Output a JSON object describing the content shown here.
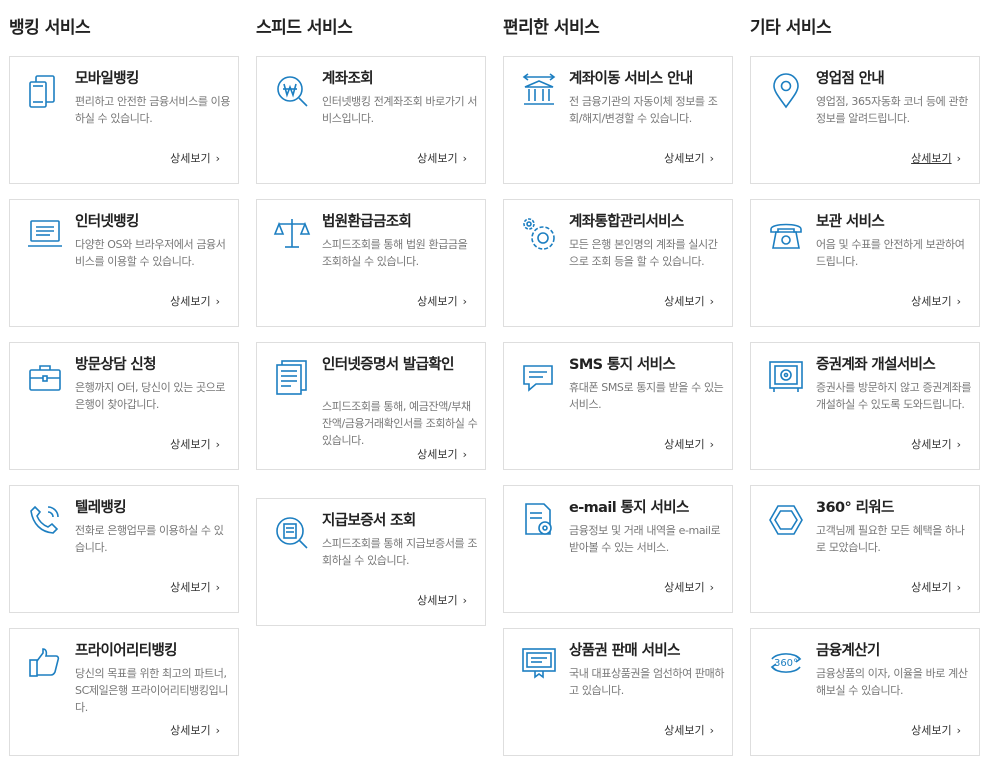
{
  "more_label": "상세보기",
  "chevron": "›",
  "accent": "#1d7fc1",
  "columns": [
    {
      "title": "뱅킹 서비스",
      "cards": [
        {
          "title": "모바일뱅킹",
          "desc": "편리하고 안전한 금융서비스를 이용하실 수 있습니다.",
          "icon": "mobile-icon"
        },
        {
          "title": "인터넷뱅킹",
          "desc": "다양한 OS와 브라우저에서 금융서비스를 이용할 수 있습니다.",
          "icon": "laptop-icon"
        },
        {
          "title": "방문상담 신청",
          "desc": "은행까지 O터, 당신이 있는 곳으로 은행이 찾아갑니다.",
          "icon": "briefcase-icon"
        },
        {
          "title": "텔레뱅킹",
          "desc": "전화로 은행업무를 이용하실 수 있습니다.",
          "icon": "phone-icon"
        },
        {
          "title": "프라이어리티뱅킹",
          "desc": "당신의 목표를 위한 최고의 파트너, SC제일은행 프라이어리티뱅킹입니다.",
          "icon": "thumbs-up-icon"
        }
      ]
    },
    {
      "title": "스피드 서비스",
      "cards": [
        {
          "title": "계좌조회",
          "desc": "인터넷뱅킹 전계좌조회 바로가기 서비스입니다.",
          "icon": "won-search-icon"
        },
        {
          "title": "법원환급금조회",
          "desc": "스피드조회를 통해 법원 환급금을 조회하실 수 있습니다.",
          "icon": "scale-icon"
        },
        {
          "title": "인터넷증명서 발급확인",
          "desc": "스피드조회를 통해, 예금잔액/부채잔액/금융거래확인서를 조회하실 수 있습니다.",
          "icon": "document-icon"
        },
        {
          "title": "지급보증서 조회",
          "desc": "스피드조회를 통해 지급보증서를 조회하실 수 있습니다.",
          "icon": "doc-search-icon"
        }
      ]
    },
    {
      "title": "편리한 서비스",
      "cards": [
        {
          "title": "계좌이동 서비스 안내",
          "desc": "전 금융기관의 자동이체 정보를 조회/해지/변경할 수 있습니다.",
          "icon": "bank-transfer-icon"
        },
        {
          "title": "계좌통합관리서비스",
          "desc": "모든 은행 본인명의 계좌를 실시간으로 조회 등을 할 수 있습니다.",
          "icon": "gears-icon"
        },
        {
          "title": "SMS 통지 서비스",
          "desc": "휴대폰 SMS로 통지를 받을 수 있는 서비스.",
          "icon": "chat-icon"
        },
        {
          "title": "e-mail 통지 서비스",
          "desc": "금융정보 및 거래 내역을 e-mail로 받아볼 수 있는 서비스.",
          "icon": "email-doc-icon"
        },
        {
          "title": "상품권 판매 서비스",
          "desc": "국내 대표상품권을 엄선하여 판매하고 있습니다.",
          "icon": "voucher-icon"
        }
      ]
    },
    {
      "title": "기타 서비스",
      "cards": [
        {
          "title": "영업점 안내",
          "desc": "영업점, 365자동화 코너 등에 관한 정보를 알려드립니다.",
          "icon": "location-pin-icon"
        },
        {
          "title": "보관 서비스",
          "desc": "어음 및 수표를 안전하게 보관하여 드립니다.",
          "icon": "telephone-icon"
        },
        {
          "title": "증권계좌 개설서비스",
          "desc": "증권사를 방문하지 않고 증권계좌를 개설하실 수 있도록 도와드립니다.",
          "icon": "safe-icon"
        },
        {
          "title": "360° 리워드",
          "desc": "고객님께 필요한 모든 혜택을 하나로 모았습니다.",
          "icon": "hexagon-icon"
        },
        {
          "title": "금융계산기",
          "desc": "금융상품의 이자, 이율을 바로 계산해보실 수 있습니다.",
          "icon": "rotate-360-icon"
        }
      ]
    }
  ]
}
